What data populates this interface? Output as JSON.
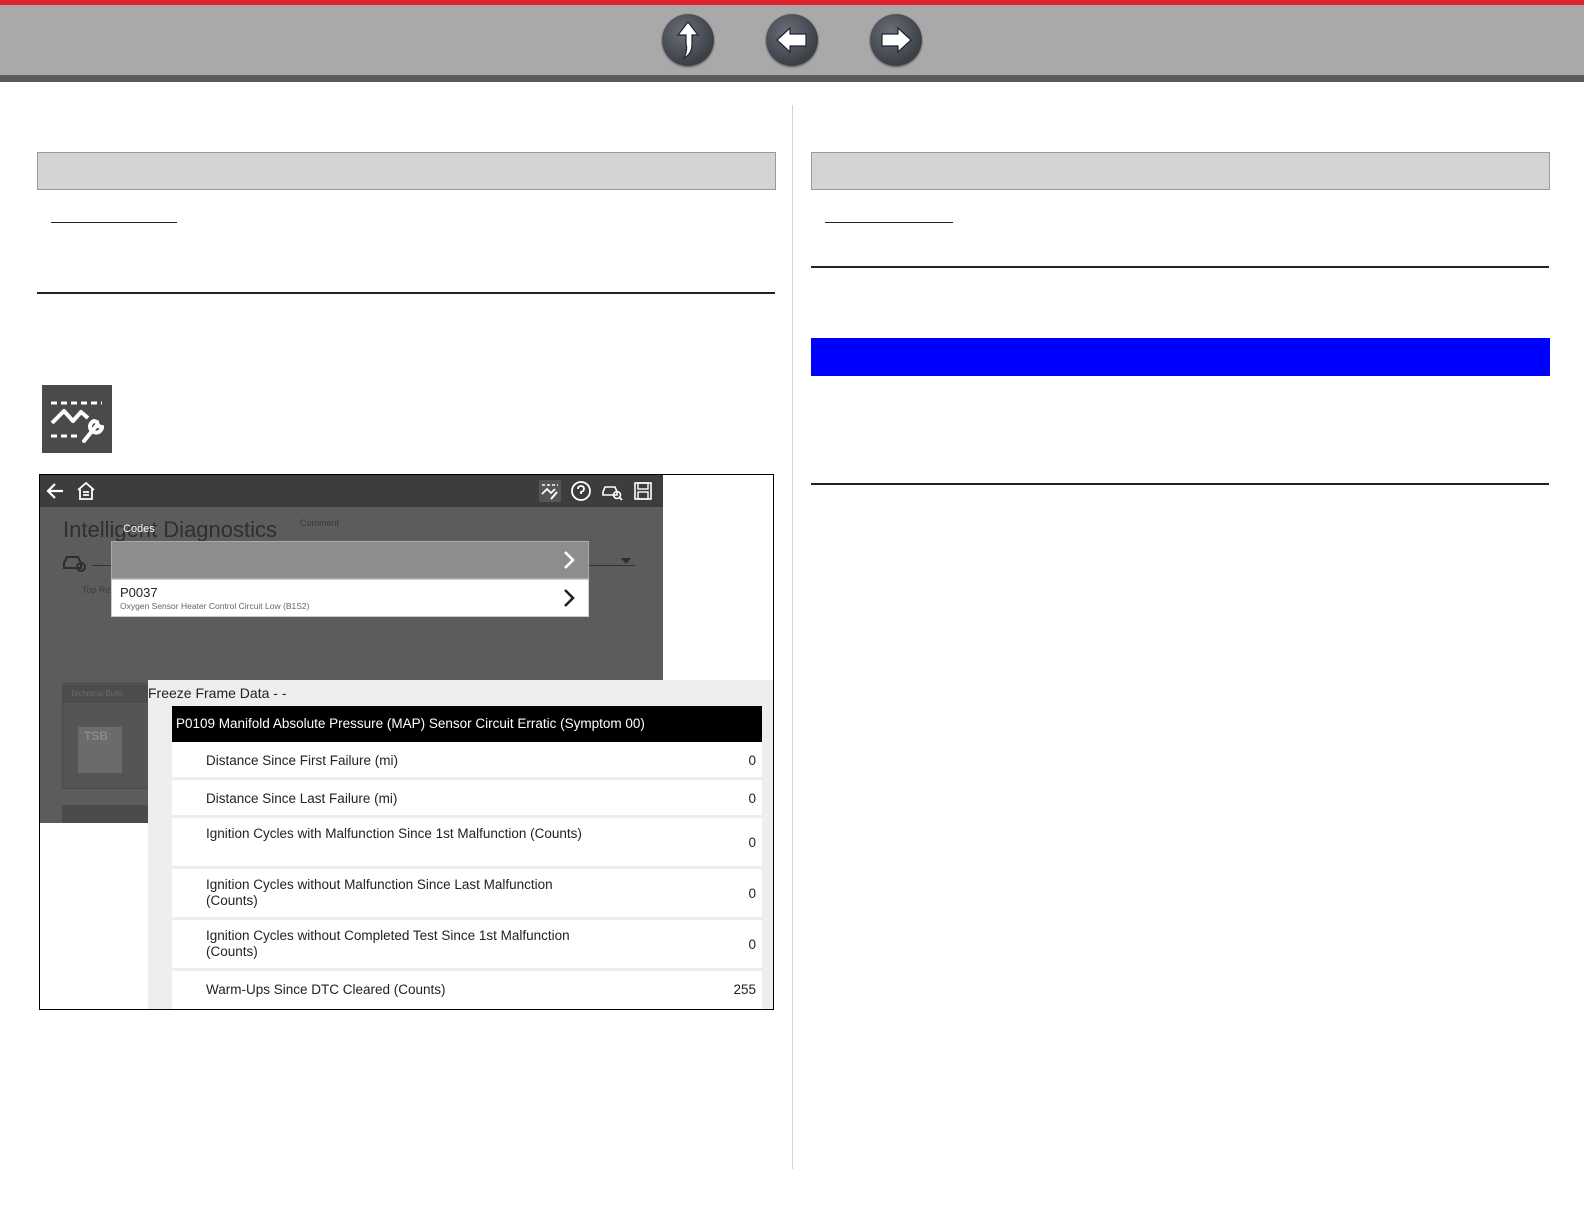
{
  "colors": {
    "accent_red": "#e0212e",
    "nav_bar": "#a9a9a9",
    "highlight_blue": "#0000ff"
  },
  "nav": {
    "buttons": [
      {
        "name": "up-arrow-icon"
      },
      {
        "name": "back-arrow-icon"
      },
      {
        "name": "forward-arrow-icon"
      }
    ]
  },
  "screenshot": {
    "background": {
      "title": "Intelligent Diagnostics",
      "subtitle": "Comment",
      "top_repairs_label": "Top Re",
      "card_header": "Technical Bulle",
      "tsb_label": "TSB"
    },
    "codes": {
      "label": "Codes",
      "selected": {
        "code": "P0037",
        "description": "Oxygen Sensor Heater Control Circuit Low (B1S2)"
      }
    },
    "freeze_frame": {
      "title": "Freeze Frame Data - -",
      "header": "P0109 Manifold Absolute Pressure (MAP) Sensor Circuit Erratic (Symptom 00)",
      "rows": [
        {
          "label": "Distance Since First Failure (mi)",
          "value": "0"
        },
        {
          "label": "Distance Since Last Failure (mi)",
          "value": "0"
        },
        {
          "label": "Ignition Cycles with Malfunction Since 1st Malfunction (Counts)",
          "value": "0"
        },
        {
          "label": "Ignition Cycles without Malfunction Since Last Malfunction (Counts)",
          "value": "0"
        },
        {
          "label": "Ignition Cycles without Completed Test Since 1st Malfunction (Counts)",
          "value": "0"
        },
        {
          "label": "Warm-Ups Since DTC Cleared (Counts)",
          "value": "255"
        }
      ]
    }
  }
}
